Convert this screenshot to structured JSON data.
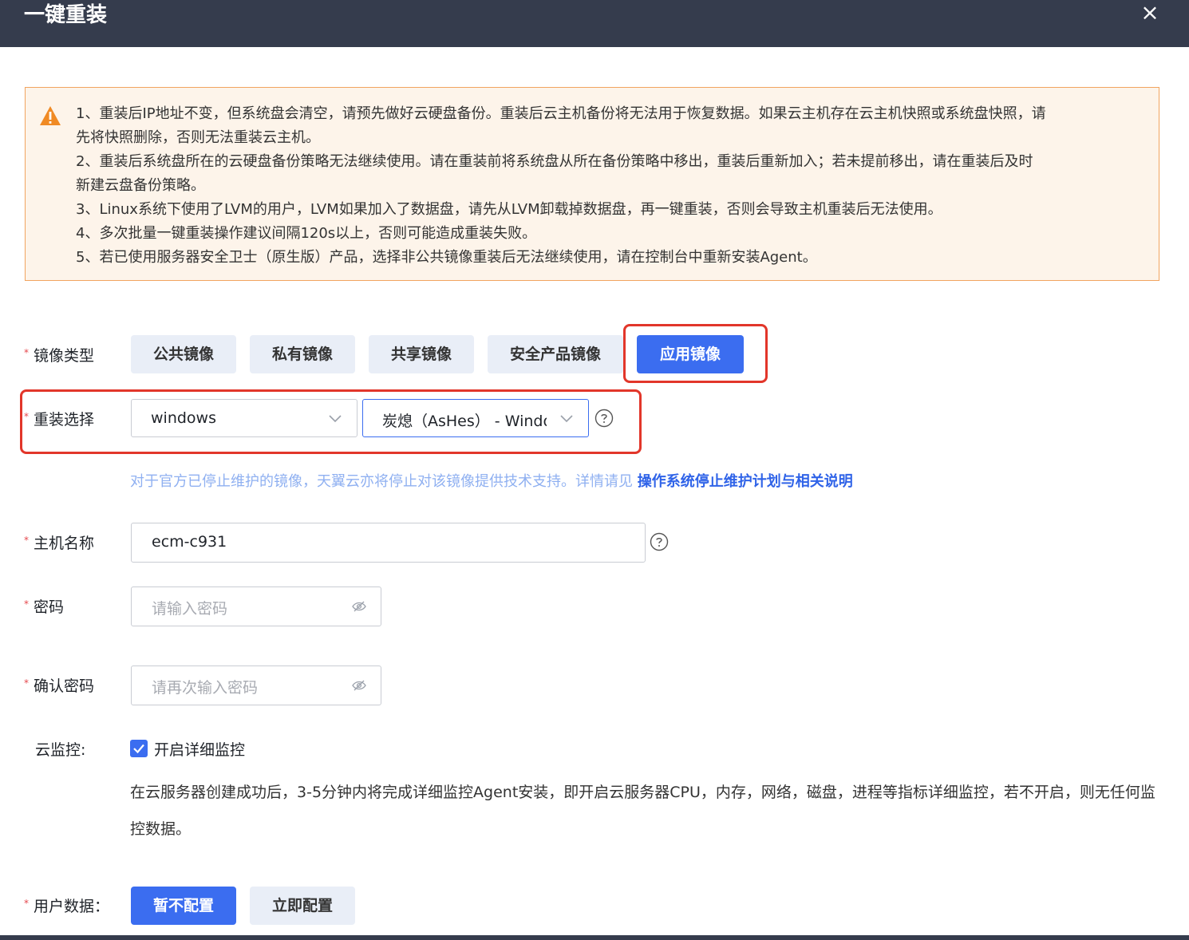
{
  "dialog": {
    "title": "一键重装",
    "close_symbol": "×"
  },
  "alert": {
    "icon": "warning-icon",
    "lines": [
      "1、重装后IP地址不变，但系统盘会清空，请预先做好云硬盘备份。重装后云主机备份将无法用于恢复数据。如果云主机存在云主机快照或系统盘快照，请",
      "先将快照删除，否则无法重装云主机。",
      "2、重装后系统盘所在的云硬盘备份策略无法继续使用。请在重装前将系统盘从所在备份策略中移出，重装后重新加入；若未提前移出，请在重装后及时",
      "新建云盘备份策略。",
      "3、Linux系统下使用了LVM的用户，LVM如果加入了数据盘，请先从LVM卸载掉数据盘，再一键重装，否则会导致主机重装后无法使用。",
      "4、多次批量一键重装操作建议间隔120s以上，否则可能造成重装失败。",
      "5、若已使用服务器安全卫士（原生版）产品，选择非公共镜像重装后无法继续使用，请在控制台中重新安装Agent。"
    ]
  },
  "image_type": {
    "label": "镜像类型",
    "options": [
      "公共镜像",
      "私有镜像",
      "共享镜像",
      "安全产品镜像",
      "应用镜像"
    ],
    "selected": "应用镜像"
  },
  "reinstall": {
    "label": "重装选择",
    "os_value": "windows",
    "image_value": "炭熄（AsHes） - Windows"
  },
  "notice": {
    "text": "对于官方已停止维护的镜像，天翼云亦将停止对该镜像提供技术支持。详情请见 ",
    "link": "操作系统停止维护计划与相关说明"
  },
  "hostname": {
    "label": "主机名称",
    "value": "ecm-c931"
  },
  "password": {
    "label": "密码",
    "placeholder": "请输入密码"
  },
  "confirm_password": {
    "label": "确认密码",
    "placeholder": "请再次输入密码"
  },
  "monitor": {
    "label": "云监控:",
    "checkbox_label": "开启详细监控",
    "checked": true,
    "description": "在云服务器创建成功后，3-5分钟内将完成详细监控Agent安装，即开启云服务器CPU，内存，网络，磁盘，进程等指标详细监控，若不开启，则无任何监控数据。"
  },
  "user_data": {
    "label": "用户数据：",
    "options": [
      "暂不配置",
      "立即配置"
    ],
    "selected": "暂不配置"
  },
  "required_mark": "*",
  "colors": {
    "header_bg": "#353c4d",
    "primary": "#3b6df0",
    "alert_bg": "#fdf4ea",
    "alert_border": "#f1a45f",
    "highlight_box": "#e2362a"
  }
}
